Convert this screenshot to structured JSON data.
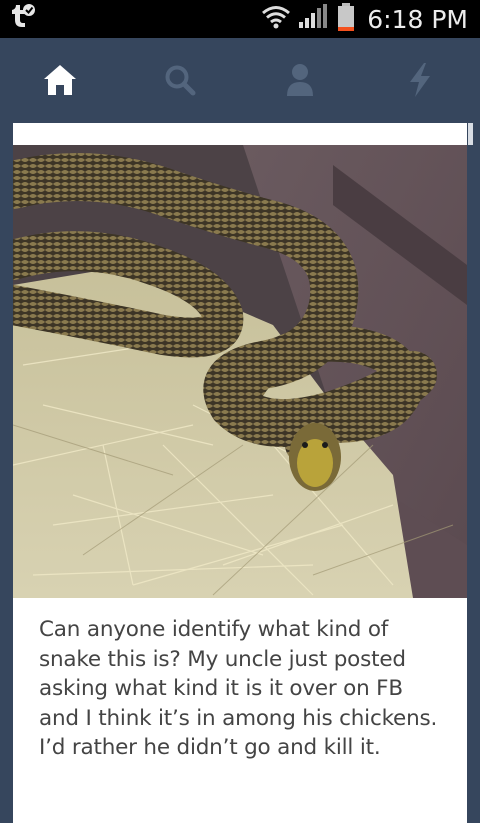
{
  "status_bar": {
    "time": "6:18 PM",
    "notification_icon": "tumblr-notification-icon",
    "icons": [
      "wifi-icon",
      "signal-icon",
      "battery-icon"
    ]
  },
  "nav": {
    "items": [
      {
        "name": "home",
        "icon": "home-icon",
        "active": true
      },
      {
        "name": "search",
        "icon": "search-icon",
        "active": false
      },
      {
        "name": "account",
        "icon": "person-icon",
        "active": false
      },
      {
        "name": "activity",
        "icon": "lightning-icon",
        "active": false
      }
    ]
  },
  "post": {
    "image": "snake-in-hay-photo",
    "caption": "Can anyone identify what kind of snake this is? My uncle just posted asking what kind it is it over on FB and I think it’s in among his chickens. I’d rather he didn’t go and kill it."
  },
  "colors": {
    "nav_background": "#36465d",
    "nav_active": "#ffffff",
    "nav_inactive": "#53657d",
    "status_bar": "#000000",
    "battery_low": "#f4511e"
  }
}
